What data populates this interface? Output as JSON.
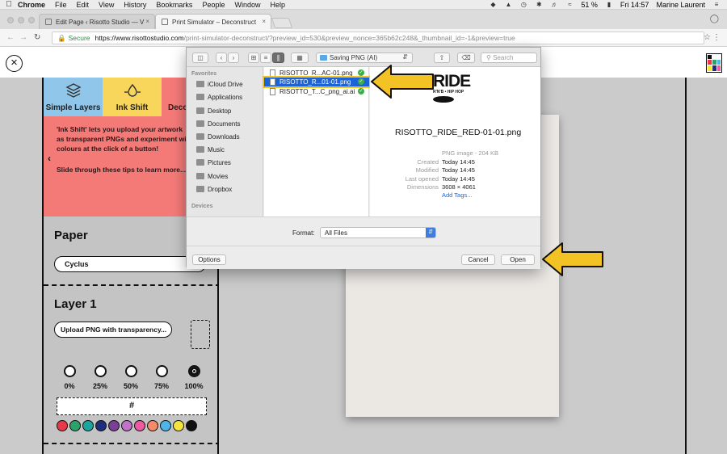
{
  "menubar": {
    "app": "Chrome",
    "menus": [
      "File",
      "Edit",
      "View",
      "History",
      "Bookmarks",
      "People",
      "Window",
      "Help"
    ],
    "battery": "51 %",
    "clock": "Fri 14:57",
    "user": "Marine Laurent"
  },
  "tabs": [
    {
      "title": "Edit Page ‹ Risotto Studio — V"
    },
    {
      "title": "Print Simulator – Deconstruct"
    }
  ],
  "address": {
    "secure_label": "Secure",
    "url_host": "https://www.risottostudio.com",
    "url_path": "/print-simulator-deconstruct/?preview_id=530&preview_nonce=365b62c248&_thumbnail_id=-1&preview=true"
  },
  "sidebar": {
    "tabs": [
      "Simple Layers",
      "Ink Shift",
      "Deco"
    ],
    "tip_1": "'Ink Shift' lets you upload your artwork",
    "tip_2": "as transparent PNGs and experiment wi",
    "tip_3": "colours at the click of a button!",
    "tip_4": "Slide through these tips to learn more...",
    "paper_title": "Paper",
    "paper_value": "Cyclus",
    "layer_title": "Layer 1",
    "upload_label": "Upload PNG with transparency...",
    "opacity": [
      "0%",
      "25%",
      "50%",
      "75%",
      "100%"
    ],
    "hex_placeholder": "#",
    "swatch_colors": [
      "#e8394a",
      "#2ea06a",
      "#1aa5a0",
      "#1f2e7a",
      "#7b3f98",
      "#c173c8",
      "#ec5aa0",
      "#f38b6b",
      "#4db6e8",
      "#f6e43a",
      "#111111"
    ]
  },
  "dialog": {
    "location": "Saving PNG (AI)",
    "search_placeholder": "Search",
    "sidebar_sections": [
      "Favorites",
      "Devices"
    ],
    "favorites": [
      "iCloud Drive",
      "Applications",
      "Desktop",
      "Documents",
      "Downloads",
      "Music",
      "Pictures",
      "Movies",
      "Dropbox"
    ],
    "files": [
      {
        "name": "RISOTTO_R...AC-01.png"
      },
      {
        "name": "RISOTTO_R...01-01.png"
      },
      {
        "name": "RISOTTO_T...C_png_ai.ai"
      }
    ],
    "preview": {
      "logo_text": "RIDE",
      "logo_sub": "R'N'B • HIP HOP",
      "filename": "RISOTTO_RIDE_RED-01-01.png",
      "kind": "PNG image - 204 KB",
      "meta_labels": [
        "Created",
        "Modified",
        "Last opened",
        "Dimensions"
      ],
      "meta_values": [
        "Today 14:45",
        "Today 14:45",
        "Today 14:45",
        "3608 × 4061"
      ],
      "add_tags": "Add Tags..."
    },
    "format_label": "Format:",
    "format_value": "All Files",
    "options_label": "Options",
    "cancel_label": "Cancel",
    "open_label": "Open"
  },
  "colors": {
    "arrow_fill": "#f3c325",
    "selection": "#1c63d6",
    "tip_panel": "#f47a78"
  }
}
